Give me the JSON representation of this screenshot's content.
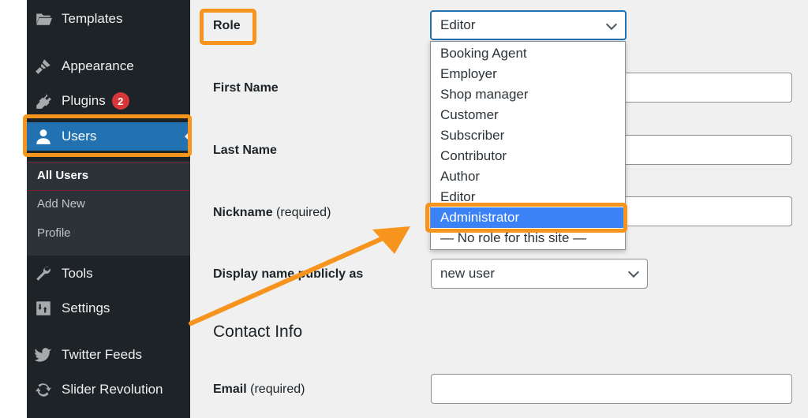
{
  "sidebar": {
    "items": [
      {
        "label": "Templates",
        "icon": "folder-icon"
      },
      {
        "label": "Appearance",
        "icon": "paintbrush-icon"
      },
      {
        "label": "Plugins",
        "icon": "plugin-icon",
        "badge": "2"
      },
      {
        "label": "Users",
        "icon": "user-icon",
        "active": true
      },
      {
        "label": "Tools",
        "icon": "wrench-icon"
      },
      {
        "label": "Settings",
        "icon": "settings-icon"
      },
      {
        "label": "Twitter Feeds",
        "icon": "twitter-icon"
      },
      {
        "label": "Slider Revolution",
        "icon": "refresh-icon"
      }
    ],
    "submenu": [
      {
        "label": "All Users",
        "current": true
      },
      {
        "label": "Add New"
      },
      {
        "label": "Profile"
      }
    ]
  },
  "form": {
    "role_label": "Role",
    "role_value": "Editor",
    "first_name_label": "First Name",
    "last_name_label": "Last Name",
    "nickname_label": "Nickname",
    "nickname_required": "(required)",
    "display_name_label": "Display name publicly as",
    "display_name_value": "new user",
    "contact_title": "Contact Info",
    "email_label": "Email",
    "email_required": "(required)"
  },
  "role_dropdown": {
    "options": [
      "Booking Agent",
      "Employer",
      "Shop manager",
      "Customer",
      "Subscriber",
      "Contributor",
      "Author",
      "Editor",
      "Administrator",
      "— No role for this site —"
    ],
    "highlighted": "Administrator"
  },
  "colors": {
    "highlight": "#f7941d",
    "sidebar_bg": "#1d2327",
    "active_menu": "#2271b1",
    "option_selected": "#3b82f6",
    "badge": "#d63638"
  }
}
